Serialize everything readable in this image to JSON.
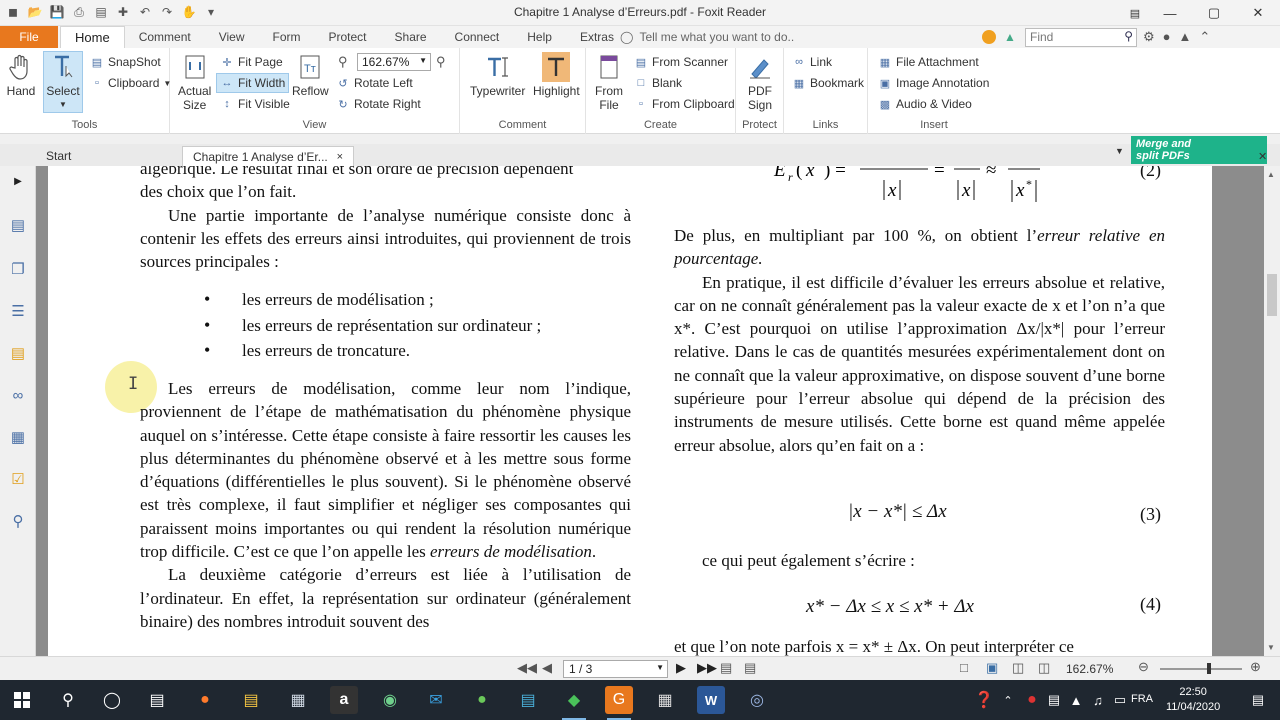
{
  "window": {
    "title": "Chapitre 1 Analyse d’Erreurs.pdf - Foxit Reader"
  },
  "ribbon_tabs": {
    "file": "File",
    "tabs": [
      "Home",
      "Comment",
      "View",
      "Form",
      "Protect",
      "Share",
      "Connect",
      "Help",
      "Extras"
    ],
    "tell_me": "Tell me what you want to do..",
    "find_placeholder": "Find"
  },
  "tools": {
    "hand": "Hand",
    "select": "Select",
    "snapshot": "SnapShot",
    "clipboard": "Clipboard",
    "label": "Tools"
  },
  "view": {
    "actual_size_1": "Actual",
    "actual_size_2": "Size",
    "fit_page": "Fit Page",
    "fit_width": "Fit Width",
    "fit_visible": "Fit Visible",
    "reflow": "Reflow",
    "zoom": "162.67%",
    "rotate_left": "Rotate Left",
    "rotate_right": "Rotate Right",
    "label": "View"
  },
  "comment": {
    "typewriter": "Typewriter",
    "highlight": "Highlight",
    "label": "Comment"
  },
  "create": {
    "from_file_1": "From",
    "from_file_2": "File",
    "from_scanner": "From Scanner",
    "blank": "Blank",
    "from_clipboard": "From Clipboard",
    "label": "Create"
  },
  "protect": {
    "pdf_sign_1": "PDF",
    "pdf_sign_2": "Sign",
    "label": "Protect"
  },
  "links": {
    "link": "Link",
    "bookmark": "Bookmark",
    "label": "Links"
  },
  "insert": {
    "file_attachment": "File Attachment",
    "image_annotation": "Image Annotation",
    "audio_video": "Audio & Video",
    "label": "Insert"
  },
  "doc_tabs": {
    "start": "Start",
    "current": "Chapitre 1 Analyse d’Er...",
    "close": "×"
  },
  "promo": {
    "line1": "Merge and",
    "line2": "split PDFs"
  },
  "document": {
    "left": {
      "line_cut": "algébrique. Le résultat final et son ordre de précision dépendent",
      "p0": "des choix que l’on fait.",
      "p1": "Une partie importante de l’analyse numérique consiste donc à contenir les effets des erreurs ainsi introduites, qui proviennent de trois sources principales :",
      "bullets": [
        "les erreurs de modélisation ;",
        "les erreurs de représentation sur ordinateur ;",
        "les erreurs de troncature."
      ],
      "p2_a": "Les erreurs de modélisation, comme leur nom l’indique, proviennent de l’étape de mathématisation du phénomène physique auquel on s’intéresse. Cette étape consiste à faire ressortir les causes les plus déterminantes du phénomène observé et à les mettre sous forme d’équations (différentielles le plus souvent). Si le phénomène observé est très complexe, il faut simplifier et négliger ses composantes qui paraissent moins importantes ou qui rendent la résolution numérique trop difficile. C’est ce que l’on appelle les ",
      "p2_em": "erreurs de modélisation",
      "p2_end": ".",
      "p3": "La deuxième catégorie d’erreurs est liée à l’utilisation de l’ordinateur. En effet, la représentation sur ordinateur (généralement binaire) des nombres introduit souvent des"
    },
    "right": {
      "eq2_top": "E",
      "eq2_num": "(2)",
      "p1_a": "De plus, en multipliant par 100 %, on obtient l’",
      "p1_em": "erreur relative en pourcentage.",
      "p2": "En pratique, il est difficile d’évaluer les erreurs absolue et relative, car on ne connaît généralement pas la valeur exacte de x et l’on n’a que x*. C’est pourquoi on utilise l’approximation Δx/|x*| pour l’erreur relative. Dans le cas de quantités mesurées expérimentalement dont on ne connaît que la valeur approximative, on dispose souvent d’une borne supérieure pour l’erreur absolue qui dépend de la précision des instruments de mesure utilisés. Cette borne est quand même appelée erreur absolue, alors qu’en fait on a :",
      "eq3": "|x − x*| ≤ Δx",
      "eq3_num": "(3)",
      "p3": "ce qui peut également s’écrire :",
      "eq4": "x* − Δx ≤ x ≤ x* + Δx",
      "eq4_num": "(4)",
      "p4": "et que l’on note parfois x = x* ± Δx. On peut interpréter ce"
    }
  },
  "status": {
    "page": "1 / 3",
    "zoom": "162.67%"
  },
  "taskbar": {
    "lang": "FRA",
    "time": "22:50",
    "date": "11/04/2020"
  }
}
